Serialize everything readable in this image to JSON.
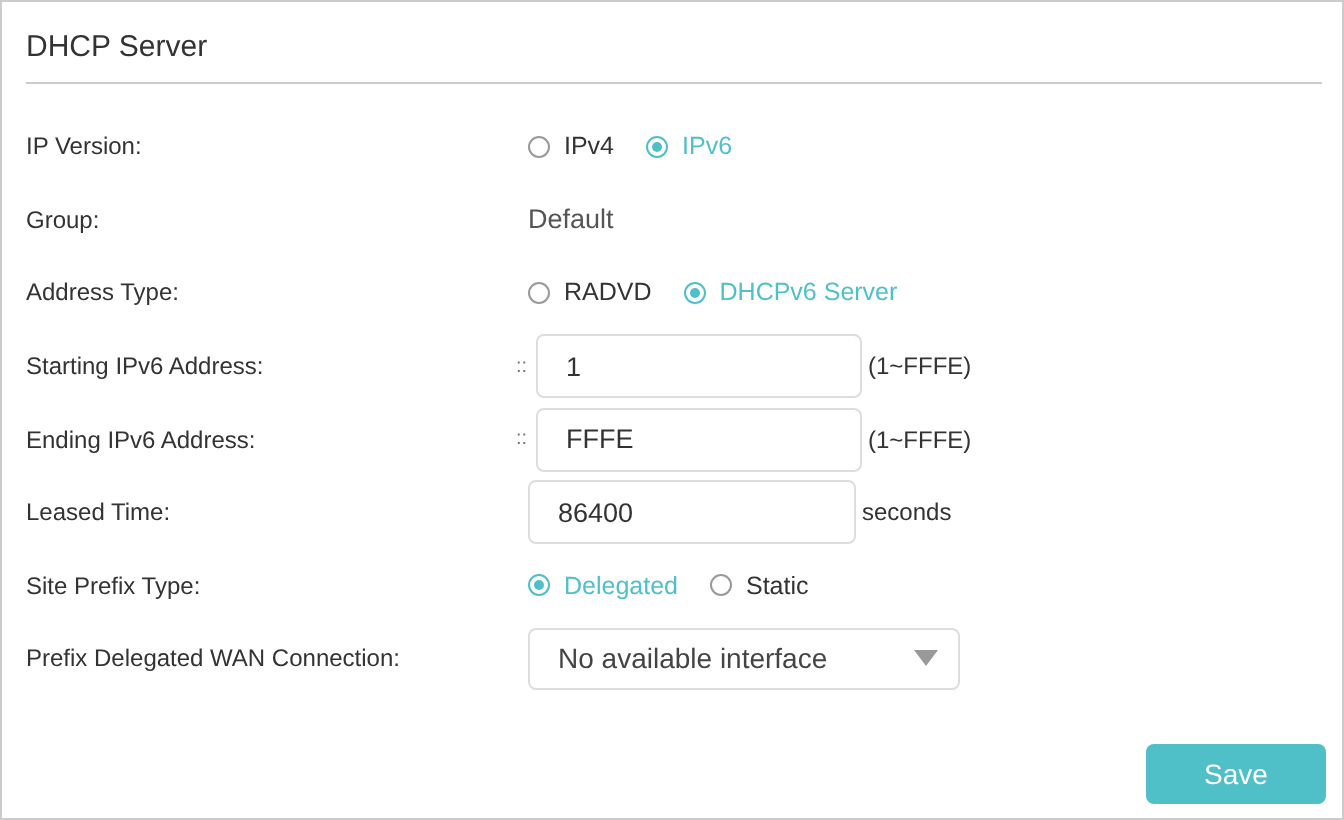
{
  "title": "DHCP Server",
  "rows": [
    {
      "kind": "radio",
      "label": "IP Version:",
      "options": [
        {
          "label": "IPv4",
          "selected": false
        },
        {
          "label": "IPv6",
          "selected": true
        }
      ]
    },
    {
      "kind": "text",
      "label": "Group:",
      "value": "Default"
    },
    {
      "kind": "radio",
      "label": "Address Type:",
      "options": [
        {
          "label": "RADVD",
          "selected": false
        },
        {
          "label": "DHCPv6 Server",
          "selected": true
        }
      ]
    },
    {
      "kind": "input",
      "label": "Starting IPv6 Address:",
      "prefix": "::",
      "value": "1",
      "suffix": "(1~FFFE)"
    },
    {
      "kind": "input",
      "label": "Ending IPv6 Address:",
      "prefix": "::",
      "value": "FFFE",
      "suffix": "(1~FFFE)"
    },
    {
      "kind": "input",
      "label": "Leased Time:",
      "value": "86400",
      "suffix": "seconds"
    },
    {
      "kind": "radio",
      "label": "Site Prefix Type:",
      "options": [
        {
          "label": "Delegated",
          "selected": true
        },
        {
          "label": "Static",
          "selected": false
        }
      ]
    },
    {
      "kind": "select",
      "label": "Prefix Delegated WAN Connection:",
      "value": "No available interface"
    }
  ],
  "save_button": "Save"
}
